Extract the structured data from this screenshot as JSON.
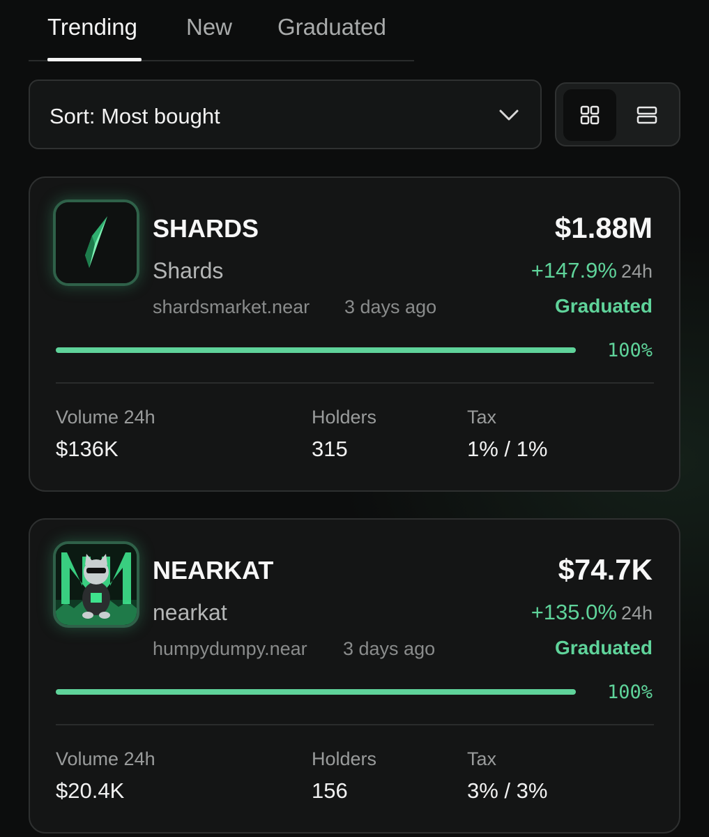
{
  "tabs": [
    {
      "label": "Trending",
      "active": true
    },
    {
      "label": "New",
      "active": false
    },
    {
      "label": "Graduated",
      "active": false
    }
  ],
  "sort": {
    "label": "Sort: Most bought",
    "icon": "chevron-down-icon"
  },
  "view_toggle": {
    "grid_icon": "grid-view-icon",
    "list_icon": "list-view-icon",
    "active": "grid"
  },
  "stat_labels": {
    "volume": "Volume 24h",
    "holders": "Holders",
    "tax": "Tax"
  },
  "colors": {
    "accent": "#5fd39a",
    "background": "#0c0d0d",
    "card": "#141515"
  },
  "tokens": [
    {
      "ticker": "SHARDS",
      "name": "Shards",
      "creator": "shardsmarket.near",
      "age": "3 days ago",
      "market_cap": "$1.88M",
      "change": "+147.9%",
      "period": "24h",
      "status": "Graduated",
      "progress": 100,
      "progress_label": "100%",
      "volume": "$136K",
      "holders": "315",
      "tax": "1% / 1%",
      "icon": "crystal-shard-icon"
    },
    {
      "ticker": "NEARKAT",
      "name": "nearkat",
      "creator": "humpydumpy.near",
      "age": "3 days ago",
      "market_cap": "$74.7K",
      "change": "+135.0%",
      "period": "24h",
      "status": "Graduated",
      "progress": 100,
      "progress_label": "100%",
      "volume": "$20.4K",
      "holders": "156",
      "tax": "3% / 3%",
      "icon": "cat-logo-icon"
    }
  ]
}
